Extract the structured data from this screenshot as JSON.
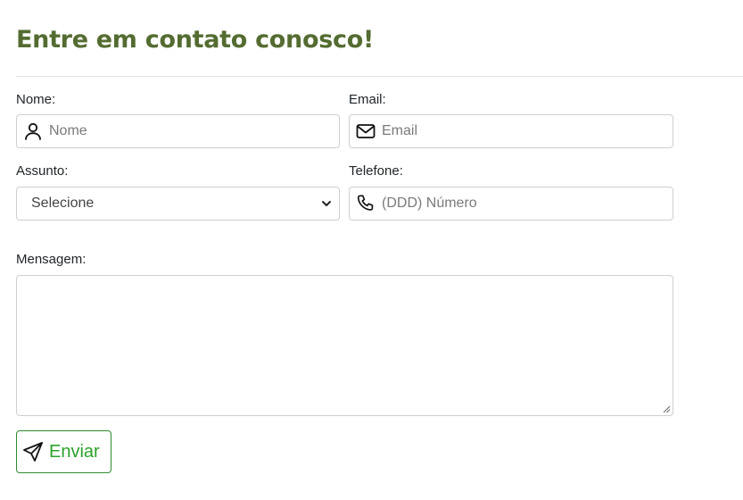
{
  "form": {
    "title": "Entre em contato conosco!",
    "name": {
      "label": "Nome:",
      "placeholder": "Nome",
      "icon": "person-icon"
    },
    "email": {
      "label": "Email:",
      "placeholder": "Email",
      "icon": "envelope-icon"
    },
    "subject": {
      "label": "Assunto:",
      "selected": "Selecione",
      "icon": "chevron-down-icon"
    },
    "phone": {
      "label": "Telefone:",
      "placeholder": "(DDD) Número",
      "icon": "phone-icon"
    },
    "message": {
      "label": "Mensagem:",
      "value": ""
    },
    "submit": {
      "label": "Enviar",
      "icon": "send-icon"
    }
  },
  "colors": {
    "title": "#546c31",
    "button_border": "#2e8b2e",
    "button_text": "#2aa22a",
    "field_border": "#cfcfcf"
  }
}
